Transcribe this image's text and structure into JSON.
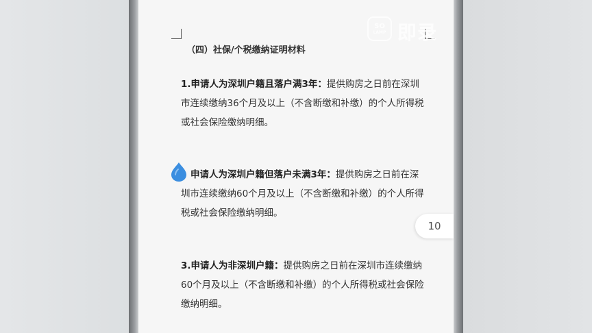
{
  "logo": {
    "box_line1": "SO",
    "box_line2": "LAMP",
    "text": "即录"
  },
  "document": {
    "heading": "（四）社保/个税缴纳证明材料",
    "items": [
      {
        "lead": "1.申请人为深圳户籍且落户满3年：",
        "body": "提供购房之日前在深圳市连续缴纳36个月及以上（不含断缴和补缴）的个人所得税或社会保险缴纳明细。"
      },
      {
        "lead": "申请人为深圳户籍但落户未满3年：",
        "body": "提供购房之日前在深圳市连续缴纳60个月及以上（不含断缴和补缴）的个人所得税或社会保险缴纳明细。"
      },
      {
        "lead": "3.申请人为非深圳户籍：",
        "body": "提供购房之日前在深圳市连续缴纳60个月及以上（不含断缴和补缴）的个人所得税或社会保险缴纳明细。"
      }
    ]
  },
  "page_indicator": "10",
  "colors": {
    "drop_icon": "#3b8ee0",
    "page_bg": "#f6f6f6",
    "text": "#333333"
  },
  "icons": {
    "drop": "water-drop-icon"
  }
}
